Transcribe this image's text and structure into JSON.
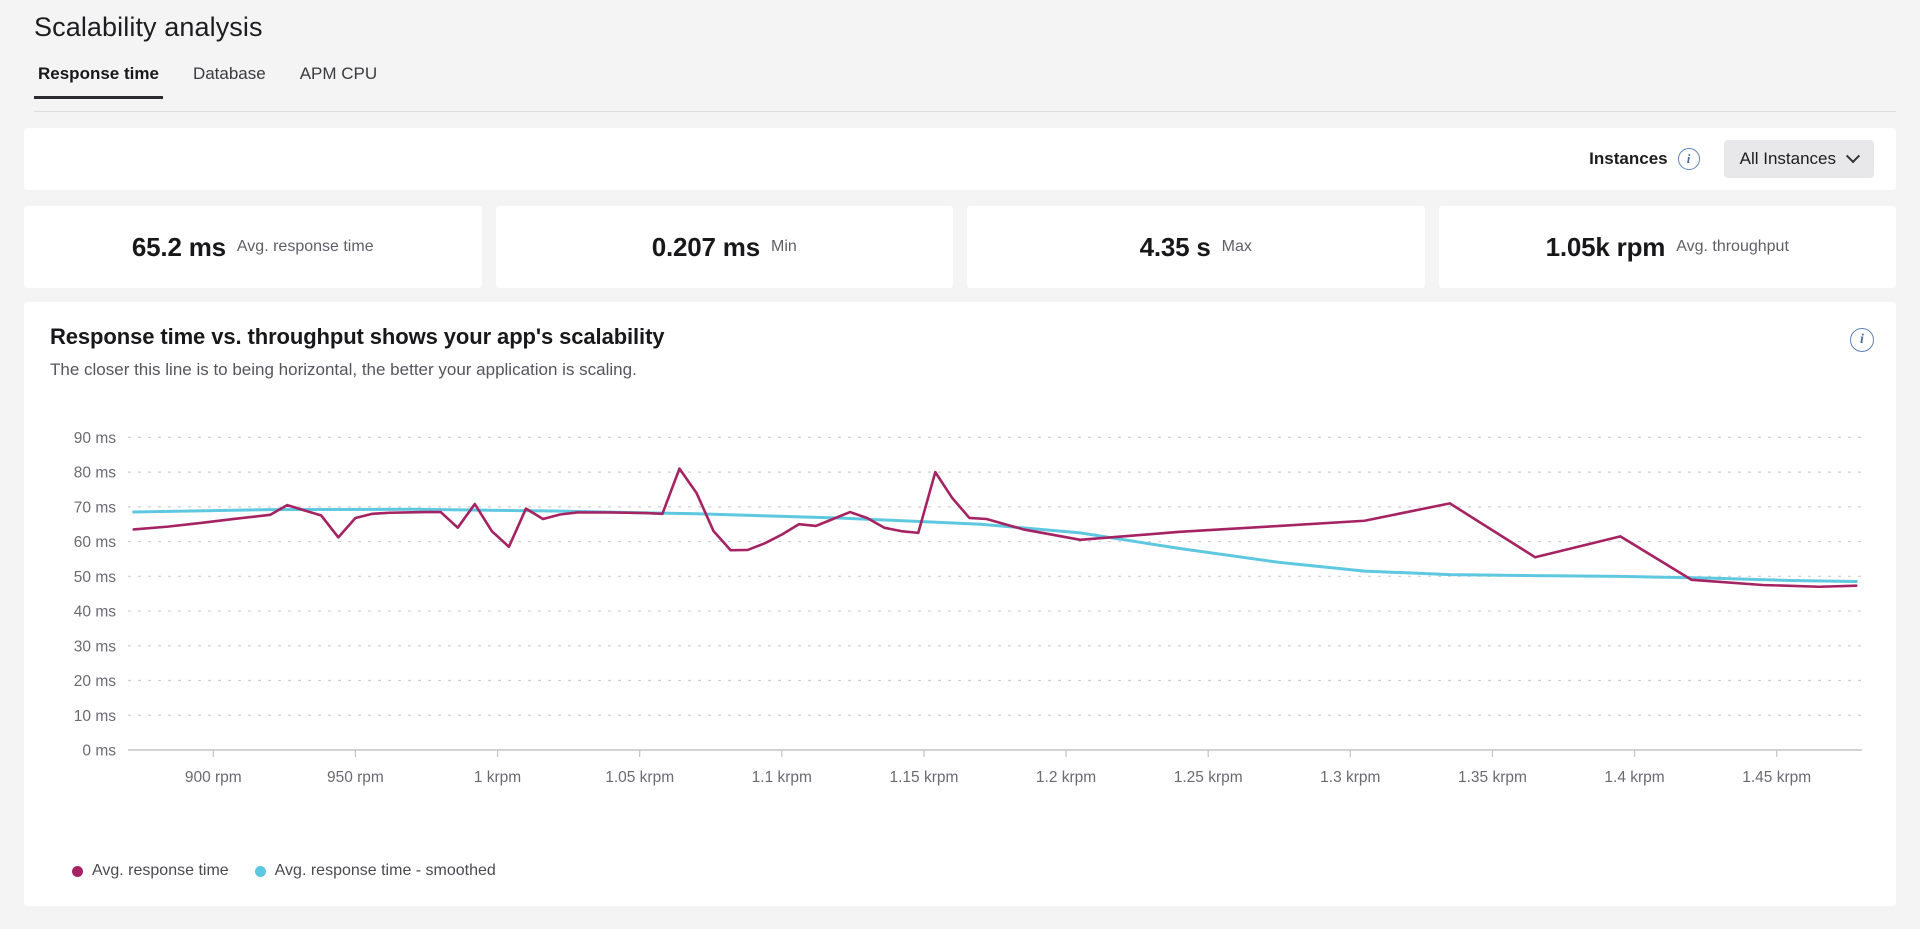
{
  "header": {
    "title": "Scalability analysis",
    "tabs": [
      {
        "label": "Response time",
        "active": true
      },
      {
        "label": "Database",
        "active": false
      },
      {
        "label": "APM CPU",
        "active": false
      }
    ]
  },
  "instances_bar": {
    "label": "Instances",
    "info_icon": "info-icon",
    "dropdown_value": "All Instances",
    "chevron_icon": "chevron-down-icon"
  },
  "stats": [
    {
      "value": "65.2 ms",
      "label": "Avg. response time"
    },
    {
      "value": "0.207 ms",
      "label": "Min"
    },
    {
      "value": "4.35 s",
      "label": "Max"
    },
    {
      "value": "1.05k rpm",
      "label": "Avg. throughput"
    }
  ],
  "chart_card": {
    "title": "Response time vs. throughput shows your app's scalability",
    "subtitle": "The closer this line is to being horizontal, the better your application is scaling.",
    "info_icon": "info-icon"
  },
  "colors": {
    "series_raw": "#a52362",
    "series_smoothed": "#5ec8e0",
    "grid": "#cfcfd4",
    "axis_text": "#6a6a72",
    "card_bg": "#ffffff",
    "page_bg": "#f4f4f5",
    "accent_dark": "#2b2b2f",
    "info_blue": "#5d82b8"
  },
  "chart_data": {
    "type": "line",
    "title": "Response time vs. throughput shows your app's scalability",
    "subtitle": "The closer this line is to being horizontal, the better your application is scaling.",
    "xlabel": "",
    "ylabel": "",
    "grid": true,
    "legend_position": "bottom-left",
    "xlim": [
      870,
      1480
    ],
    "ylim": [
      0,
      95
    ],
    "y_ticks": [
      0,
      10,
      20,
      30,
      40,
      50,
      60,
      70,
      80,
      90
    ],
    "y_tick_labels": [
      "0 ms",
      "10 ms",
      "20 ms",
      "30 ms",
      "40 ms",
      "50 ms",
      "60 ms",
      "70 ms",
      "80 ms",
      "90 ms"
    ],
    "x_ticks": [
      900,
      950,
      1000,
      1050,
      1100,
      1150,
      1200,
      1250,
      1300,
      1350,
      1400,
      1450
    ],
    "x_tick_labels": [
      "900 rpm",
      "950 rpm",
      "1 krpm",
      "1.05 krpm",
      "1.1 krpm",
      "1.15 krpm",
      "1.2 krpm",
      "1.25 krpm",
      "1.3 krpm",
      "1.35 krpm",
      "1.4 krpm",
      "1.45 krpm"
    ],
    "series": [
      {
        "name": "Avg. response time",
        "color": "#a52362",
        "x": [
          872,
          884,
          896,
          908,
          920,
          926,
          932,
          938,
          944,
          950,
          956,
          962,
          968,
          974,
          980,
          986,
          992,
          998,
          1004,
          1010,
          1016,
          1022,
          1028,
          1034,
          1040,
          1046,
          1052,
          1058,
          1064,
          1070,
          1076,
          1082,
          1088,
          1094,
          1100,
          1106,
          1112,
          1118,
          1124,
          1130,
          1136,
          1142,
          1148,
          1154,
          1160,
          1166,
          1172,
          1185,
          1205,
          1240,
          1275,
          1305,
          1335,
          1365,
          1395,
          1420,
          1445,
          1465,
          1478
        ],
        "y": [
          63.5,
          64.3,
          65.4,
          66.6,
          67.7,
          70.5,
          69.0,
          67.5,
          61.2,
          66.8,
          68.0,
          68.3,
          68.4,
          68.5,
          68.5,
          64.0,
          70.8,
          63.0,
          58.5,
          69.5,
          66.5,
          67.8,
          68.4,
          68.4,
          68.4,
          68.3,
          68.2,
          68.0,
          81.0,
          74.0,
          63.0,
          57.5,
          57.6,
          59.5,
          62.0,
          65.0,
          64.5,
          66.5,
          68.5,
          66.8,
          64.0,
          63.0,
          62.5,
          80.0,
          72.5,
          66.8,
          66.5,
          63.5,
          60.5,
          62.8,
          64.5,
          66.0,
          71.0,
          55.5,
          61.5,
          49.0,
          47.5,
          47.0,
          47.3
        ],
        "note": "dense noisy raw series, simplified polyline"
      },
      {
        "name": "Avg. response time - smoothed",
        "color": "#5ec8e0",
        "x": [
          872,
          920,
          970,
          1020,
          1070,
          1120,
          1170,
          1205,
          1240,
          1275,
          1305,
          1335,
          1365,
          1395,
          1425,
          1455,
          1478
        ],
        "y": [
          68.5,
          69.2,
          69.3,
          68.8,
          68.0,
          66.8,
          65.0,
          62.5,
          58.0,
          54.0,
          51.5,
          50.5,
          50.2,
          50.0,
          49.5,
          48.8,
          48.5
        ]
      }
    ],
    "legend": [
      {
        "label": "Avg. response time",
        "color": "#a52362"
      },
      {
        "label": "Avg. response time - smoothed",
        "color": "#5ec8e0"
      }
    ]
  }
}
